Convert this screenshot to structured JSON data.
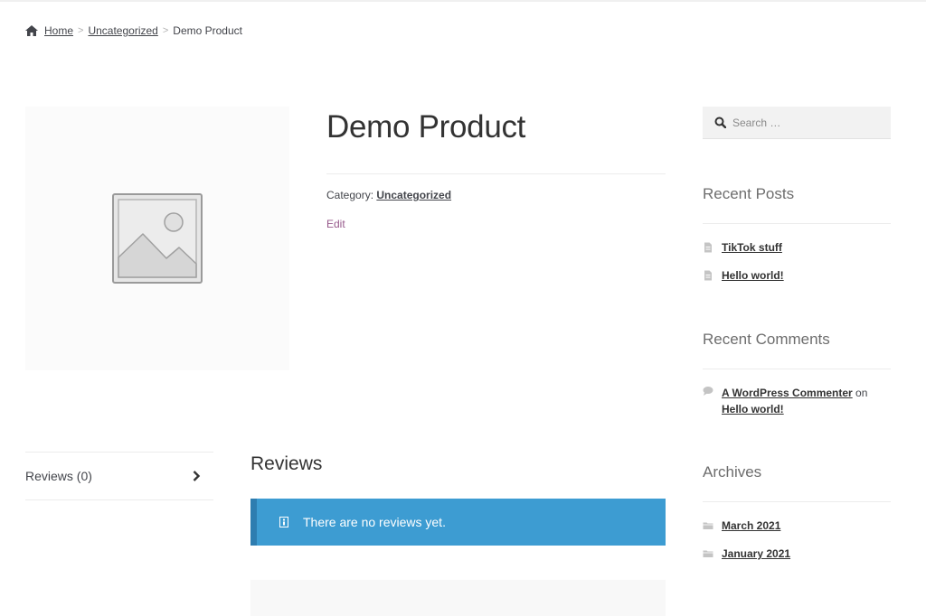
{
  "breadcrumb": {
    "home": "Home",
    "separator": ">",
    "category": "Uncategorized",
    "current": "Demo Product"
  },
  "product": {
    "title": "Demo Product",
    "category_label": "Category:",
    "category": "Uncategorized",
    "edit": "Edit",
    "image_icon": "placeholder-image-icon"
  },
  "tabs": {
    "reviews_label": "Reviews (0)"
  },
  "reviews": {
    "title": "Reviews",
    "notice": "There are no reviews yet."
  },
  "sidebar": {
    "search_placeholder": "Search …",
    "recent_posts": {
      "title": "Recent Posts",
      "items": [
        "TikTok stuff",
        "Hello world!"
      ]
    },
    "recent_comments": {
      "title": "Recent Comments",
      "author": "A WordPress Commenter",
      "connector": "on",
      "post": "Hello world!"
    },
    "archives": {
      "title": "Archives",
      "items": [
        "March 2021",
        "January 2021"
      ]
    }
  },
  "colors": {
    "accent": "#96588a",
    "notice_bg": "#3d9cd2",
    "text": "#43454b",
    "heading": "#333333"
  }
}
